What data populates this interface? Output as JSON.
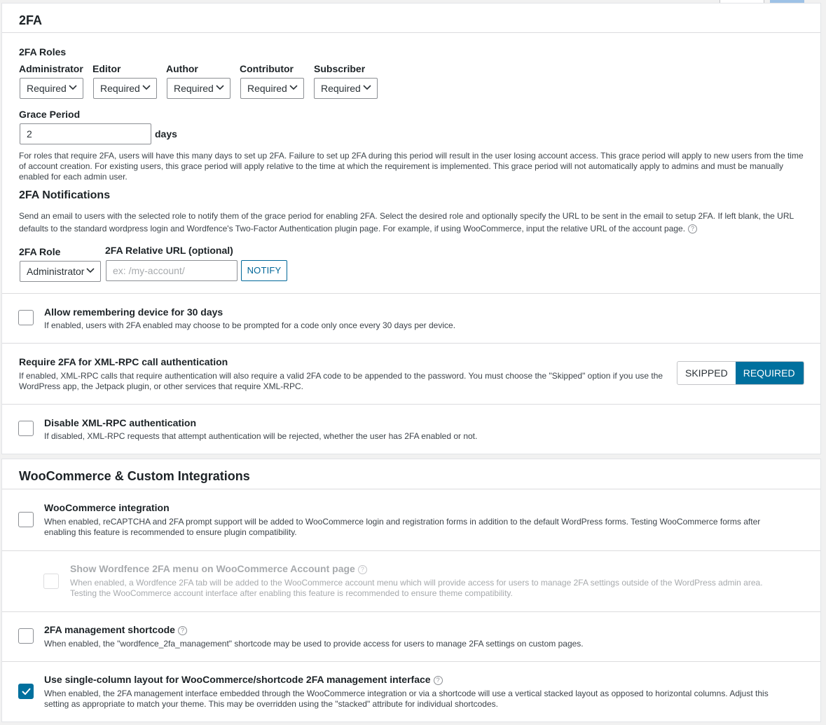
{
  "section_2fa": {
    "title": "2FA",
    "roles_label": "2FA Roles",
    "roles": [
      {
        "name": "Administrator",
        "value": "Required"
      },
      {
        "name": "Editor",
        "value": "Required"
      },
      {
        "name": "Author",
        "value": "Required"
      },
      {
        "name": "Contributor",
        "value": "Required"
      },
      {
        "name": "Subscriber",
        "value": "Required"
      }
    ],
    "grace_label": "Grace Period",
    "grace_value": "2",
    "grace_unit": "days",
    "grace_help": "For roles that require 2FA, users will have this many days to set up 2FA. Failure to set up 2FA during this period will result in the user losing account access. This grace period will apply to new users from the time of account creation. For existing users, this grace period will apply relative to the time at which the requirement is implemented. This grace period will not automatically apply to admins and must be manually enabled for each admin user.",
    "notif_title": "2FA Notifications",
    "notif_help": "Send an email to users with the selected role to notify them of the grace period for enabling 2FA. Select the desired role and optionally specify the URL to be sent in the email to setup 2FA. If left blank, the URL defaults to the standard wordpress login and Wordfence's Two-Factor Authentication plugin page. For example, if using WooCommerce, input the relative URL of the account page.",
    "notif_role_label": "2FA Role",
    "notif_role_value": "Administrator",
    "notif_url_label": "2FA Relative URL (optional)",
    "notif_url_placeholder": "ex: /my-account/",
    "notify_button": "NOTIFY",
    "remember": {
      "title": "Allow remembering device for 30 days",
      "desc": "If enabled, users with 2FA enabled may choose to be prompted for a code only once every 30 days per device."
    },
    "xmlrpc_require": {
      "title": "Require 2FA for XML-RPC call authentication",
      "desc": "If enabled, XML-RPC calls that require authentication will also require a valid 2FA code to be appended to the password. You must choose the \"Skipped\" option if you use the WordPress app, the Jetpack plugin, or other services that require XML-RPC.",
      "opt_skipped": "SKIPPED",
      "opt_required": "REQUIRED"
    },
    "xmlrpc_disable": {
      "title": "Disable XML-RPC authentication",
      "desc": "If disabled, XML-RPC requests that attempt authentication will be rejected, whether the user has 2FA enabled or not."
    }
  },
  "section_woo": {
    "title": "WooCommerce & Custom Integrations",
    "woo": {
      "title": "WooCommerce integration",
      "desc": "When enabled, reCAPTCHA and 2FA prompt support will be added to WooCommerce login and registration forms in addition to the default WordPress forms. Testing WooCommerce forms after enabling this feature is recommended to ensure plugin compatibility."
    },
    "woo_menu": {
      "title": "Show Wordfence 2FA menu on WooCommerce Account page",
      "desc": "When enabled, a Wordfence 2FA tab will be added to the WooCommerce account menu which will provide access for users to manage 2FA settings outside of the WordPress admin area. Testing the WooCommerce account interface after enabling this feature is recommended to ensure theme compatibility."
    },
    "shortcode": {
      "title": "2FA management shortcode",
      "desc": "When enabled, the \"wordfence_2fa_management\" shortcode may be used to provide access for users to manage 2FA settings on custom pages."
    },
    "single_col": {
      "title": "Use single-column layout for WooCommerce/shortcode 2FA management interface",
      "desc": "When enabled, the 2FA management interface embedded through the WooCommerce integration or via a shortcode will use a vertical stacked layout as opposed to horizontal columns. Adjust this setting as appropriate to match your theme. This may be overridden using the \"stacked\" attribute for individual shortcodes."
    }
  },
  "icons": {
    "help": "?"
  }
}
